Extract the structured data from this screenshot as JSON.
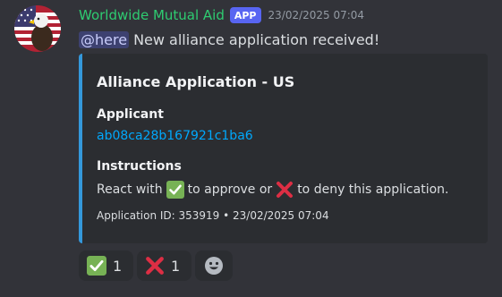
{
  "message": {
    "author": "Worldwide Mutual Aid",
    "badge": "APP",
    "timestamp": "23/02/2025 07:04",
    "mention": "@here",
    "text": "New alliance application received!"
  },
  "embed": {
    "accent_color": "#3498db",
    "title": "Alliance Application - US",
    "fields": [
      {
        "name": "Applicant",
        "value": "ab08ca28b167921c1ba6"
      },
      {
        "name": "Instructions",
        "value_before": "React with",
        "value_middle": "to approve or",
        "value_after": "to deny this application."
      }
    ],
    "footer": "Application ID: 353919 • 23/02/2025 07:04"
  },
  "reactions": [
    {
      "emoji": "check-mark-icon",
      "count": "1"
    },
    {
      "emoji": "cross-mark-icon",
      "count": "1"
    },
    {
      "emoji": "add-reaction-icon"
    }
  ],
  "colors": {
    "background": "#323339",
    "username": "#2ecc71",
    "badge": "#5865f2",
    "link": "#00a8fc",
    "embed_bg": "#2b2d31"
  }
}
